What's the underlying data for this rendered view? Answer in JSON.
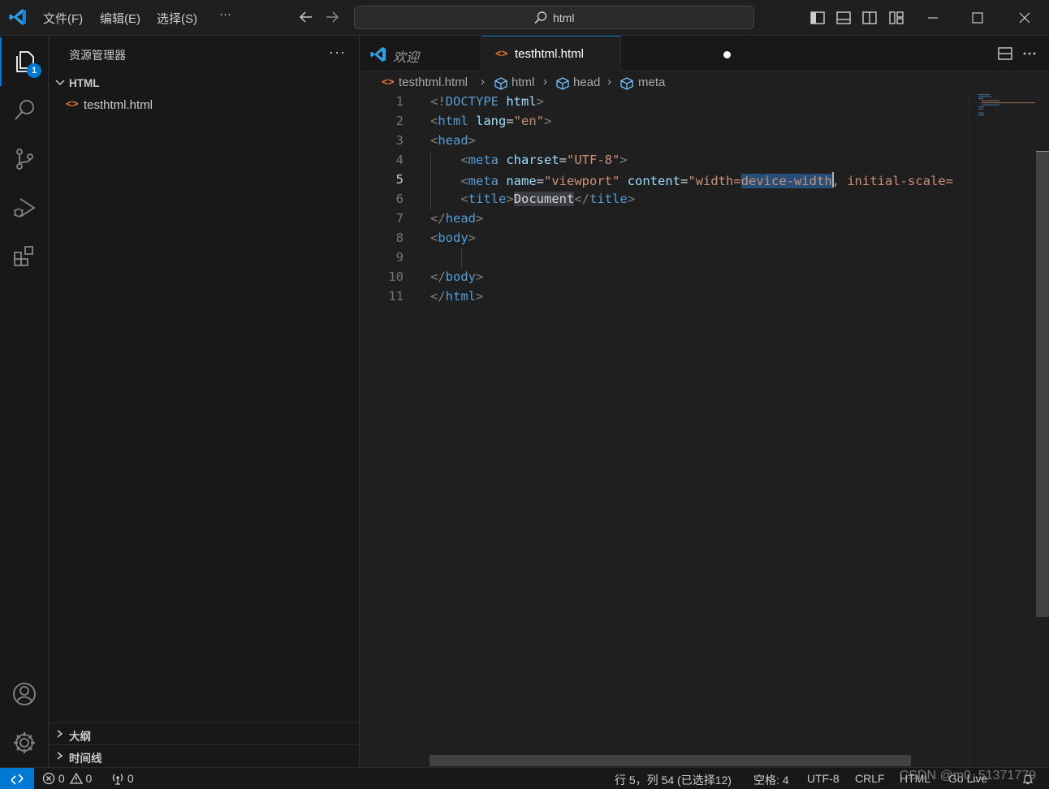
{
  "titlebar": {
    "menus": [
      "文件(F)",
      "编辑(E)",
      "选择(S)",
      "···"
    ],
    "search_text": "html"
  },
  "activitybar": {
    "explorer_badge": "1",
    "items": [
      "explorer",
      "search",
      "source-control",
      "run-and-debug",
      "extensions",
      "accounts",
      "manage"
    ]
  },
  "sidebar": {
    "title": "资源管理器",
    "more": "···",
    "folder": "HTML",
    "files": [
      {
        "icon": "<>",
        "name": "testhtml.html"
      }
    ],
    "sections": [
      "大纲",
      "时间线"
    ]
  },
  "tabs": {
    "welcome": "欢迎",
    "active": {
      "icon": "<>",
      "name": "testhtml.html",
      "modified": true
    }
  },
  "breadcrumb": [
    "testhtml.html",
    "html",
    "head",
    "meta"
  ],
  "editor": {
    "line_numbers": [
      "1",
      "2",
      "3",
      "4",
      "5",
      "6",
      "7",
      "8",
      "9",
      "10",
      "11"
    ],
    "current_line": 5,
    "lines": [
      "<!DOCTYPE html>",
      "<html lang=\"en\">",
      "<head>",
      "    <meta charset=\"UTF-8\">",
      "    <meta name=\"viewport\" content=\"width=device-width, initial-scale=",
      "    <title>Document</title>",
      "</head>",
      "<body>",
      "    ",
      "</body>",
      "</html>"
    ]
  },
  "statusbar": {
    "errors": "0",
    "warnings": "0",
    "ports": "0",
    "cursor_pos": "行 5，列 54 (已选择12)",
    "indent": "空格: 4",
    "encoding": "UTF-8",
    "eol": "CRLF",
    "language": "HTML",
    "golive": "Go Live",
    "watermark": "CSDN @m0_51371779"
  },
  "colors": {
    "accent": "#0078d4",
    "background": "#1f1f1f",
    "sidebar": "#181818",
    "html_icon": "#e37933"
  }
}
